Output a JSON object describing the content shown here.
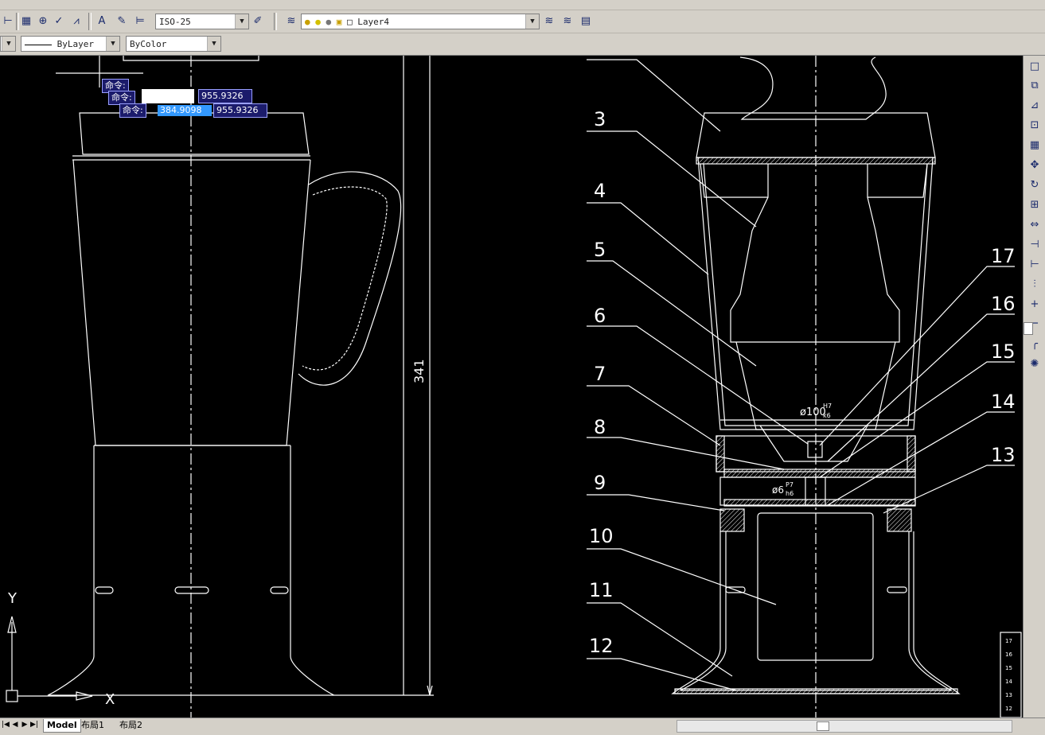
{
  "toolbar": {
    "dimstyle": "ISO-25",
    "layer": "Layer4",
    "linetype": "ByLayer",
    "color": "ByColor"
  },
  "tabs": [
    "Model",
    "布局1",
    "布局2"
  ],
  "command": {
    "label1": "命令:",
    "label2": "命令:",
    "label3": "命令:",
    "coord_y": "955.9326",
    "coord_x": "384.9098",
    "coord_y2": "955.9326"
  },
  "drawing": {
    "dimension": "341",
    "fit1": "ø100",
    "fit1_sup": "H7",
    "fit1_sub": "k6",
    "fit2": "ø6",
    "fit2_sup": "P7",
    "fit2_sub": "h6",
    "axis_y": "Y",
    "axis_x": "X",
    "callouts": [
      "3",
      "4",
      "5",
      "6",
      "7",
      "8",
      "9",
      "10",
      "11",
      "12",
      "17",
      "16",
      "15",
      "14",
      "13"
    ],
    "table": [
      "17",
      "16",
      "15",
      "14",
      "13",
      "12"
    ]
  },
  "icons": [
    "layer-manager-icon",
    "lightbulb-icon",
    "sun-icon",
    "lock-icon",
    "color-swatch-icon"
  ],
  "colors": {
    "canvas": "#000000",
    "line": "#ffffff",
    "hatch": "#ffffff"
  }
}
